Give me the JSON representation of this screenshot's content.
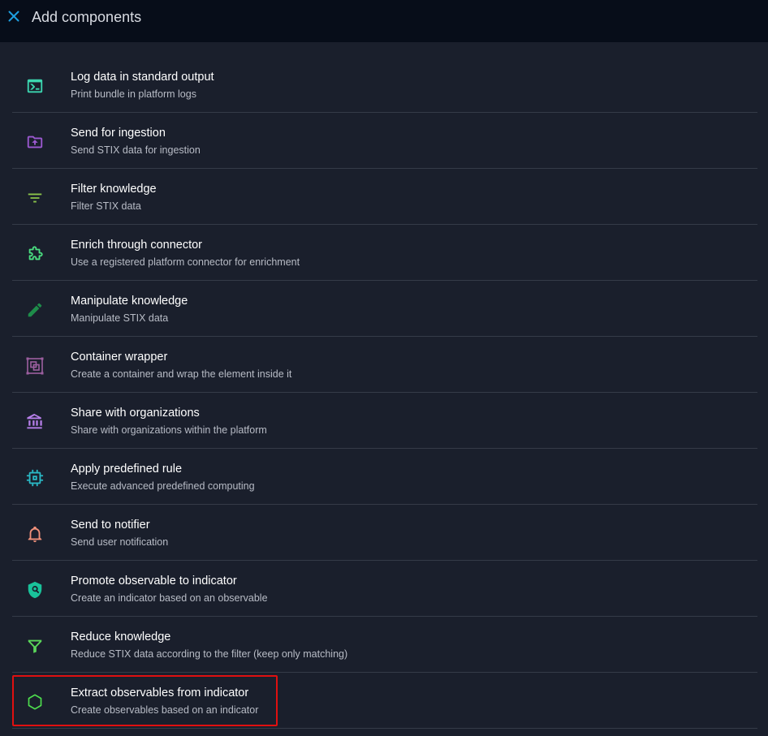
{
  "header": {
    "title": "Add components",
    "close_icon": "close-icon"
  },
  "components": [
    {
      "title": "Log data in standard output",
      "subtitle": "Print bundle in platform logs",
      "icon": "console-icon",
      "color": "#3cd6b0"
    },
    {
      "title": "Send for ingestion",
      "subtitle": "Send STIX data for ingestion",
      "icon": "folder-upload-icon",
      "color": "#9c59d1"
    },
    {
      "title": "Filter knowledge",
      "subtitle": "Filter STIX data",
      "icon": "filter-list-icon",
      "color": "#8bc34a"
    },
    {
      "title": "Enrich through connector",
      "subtitle": "Use a registered platform connector for enrichment",
      "icon": "puzzle-icon",
      "color": "#4ade80"
    },
    {
      "title": "Manipulate knowledge",
      "subtitle": "Manipulate STIX data",
      "icon": "pencil-icon",
      "color": "#1e8c4a"
    },
    {
      "title": "Container wrapper",
      "subtitle": "Create a container and wrap the element inside it",
      "icon": "select-group-icon",
      "color": "#9c5fa0"
    },
    {
      "title": "Share with organizations",
      "subtitle": "Share with organizations within the platform",
      "icon": "bank-icon",
      "color": "#b57ee8"
    },
    {
      "title": "Apply predefined rule",
      "subtitle": "Execute advanced predefined computing",
      "icon": "chip-icon",
      "color": "#2ab7c4"
    },
    {
      "title": "Send to notifier",
      "subtitle": "Send user notification",
      "icon": "bell-icon",
      "color": "#f0907a"
    },
    {
      "title": "Promote observable to indicator",
      "subtitle": "Create an indicator based on an observable",
      "icon": "shield-search-icon",
      "color": "#19c29a"
    },
    {
      "title": "Reduce knowledge",
      "subtitle": "Reduce STIX data according to the filter (keep only matching)",
      "icon": "funnel-icon",
      "color": "#5ad65a"
    },
    {
      "title": "Extract observables from indicator",
      "subtitle": "Create observables based on an indicator",
      "icon": "hexagon-outline-icon",
      "color": "#4ee04e"
    }
  ],
  "colors": {
    "header_bg": "#070d19",
    "page_bg": "#1a1f2c",
    "accent": "#1e9fe0",
    "highlight": "#e01010"
  }
}
